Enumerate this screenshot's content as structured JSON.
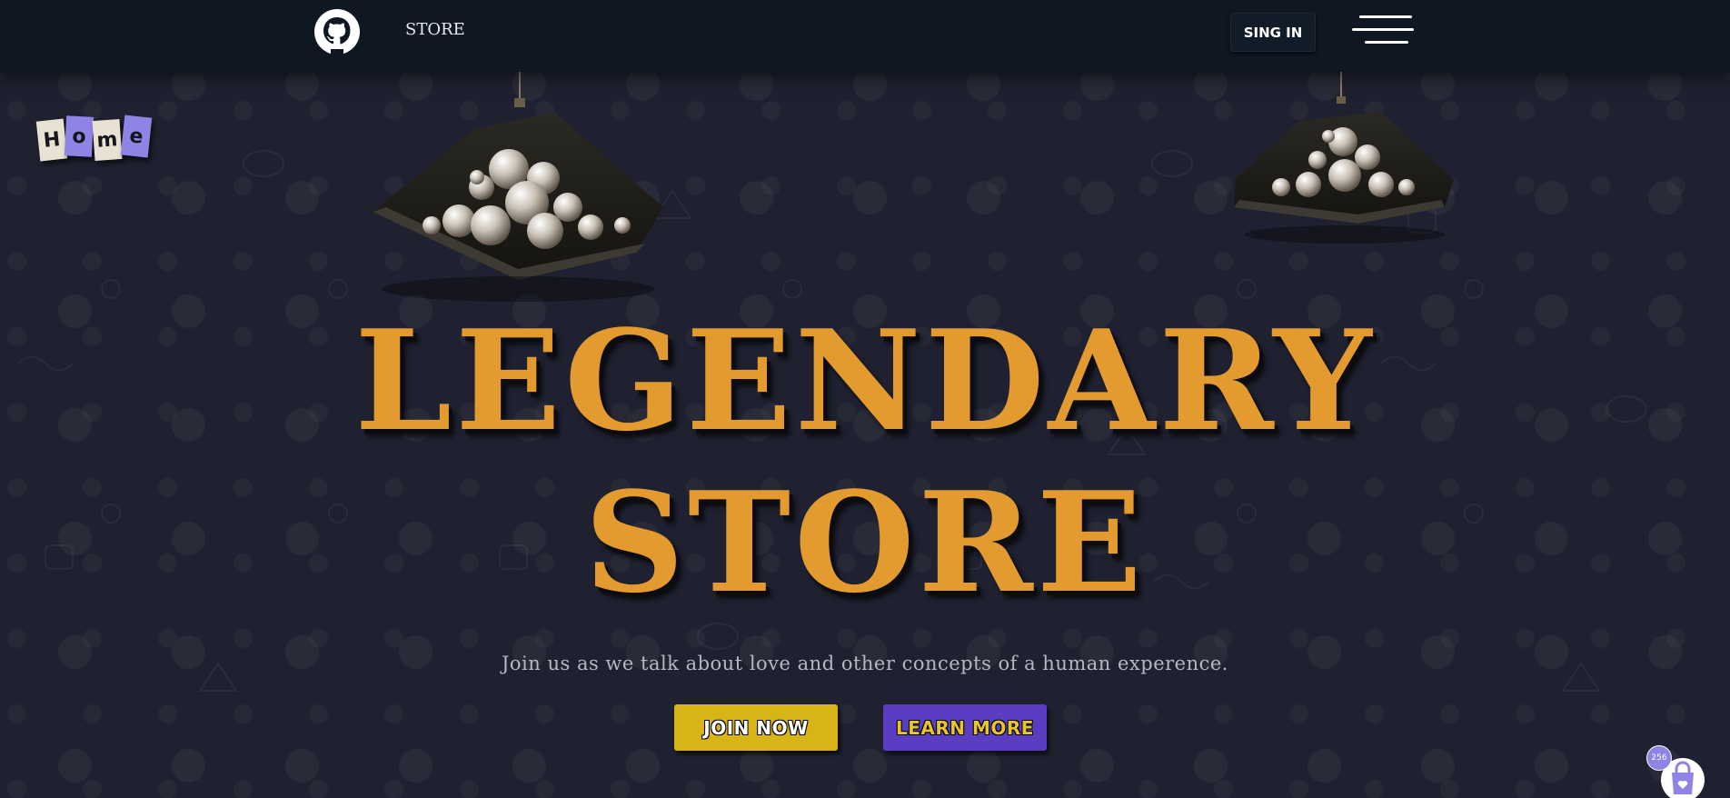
{
  "navbar": {
    "logo_icon": "github-icon",
    "store_label": "STORE",
    "signin_label": "SING IN",
    "menu_icon": "hamburger-menu-icon"
  },
  "home_tiles": {
    "letters": [
      "H",
      "o",
      "m",
      "e"
    ]
  },
  "hero": {
    "title_line1": "LEGENDARY",
    "title_line2": "STORE",
    "subtitle": "Join us as we talk about love and other concepts of a human experence.",
    "join_label": "JOIN NOW",
    "learn_label": "LEARN MORE"
  },
  "cart": {
    "icon": "shopping-bag-icon",
    "badge": "256"
  },
  "colors": {
    "background": "#1f2130",
    "navbar": "#0f1722",
    "title": "#e39a2e",
    "join_button": "#d8b516",
    "learn_button": "#5b3dc2",
    "accent_purple": "#8f84e6"
  }
}
